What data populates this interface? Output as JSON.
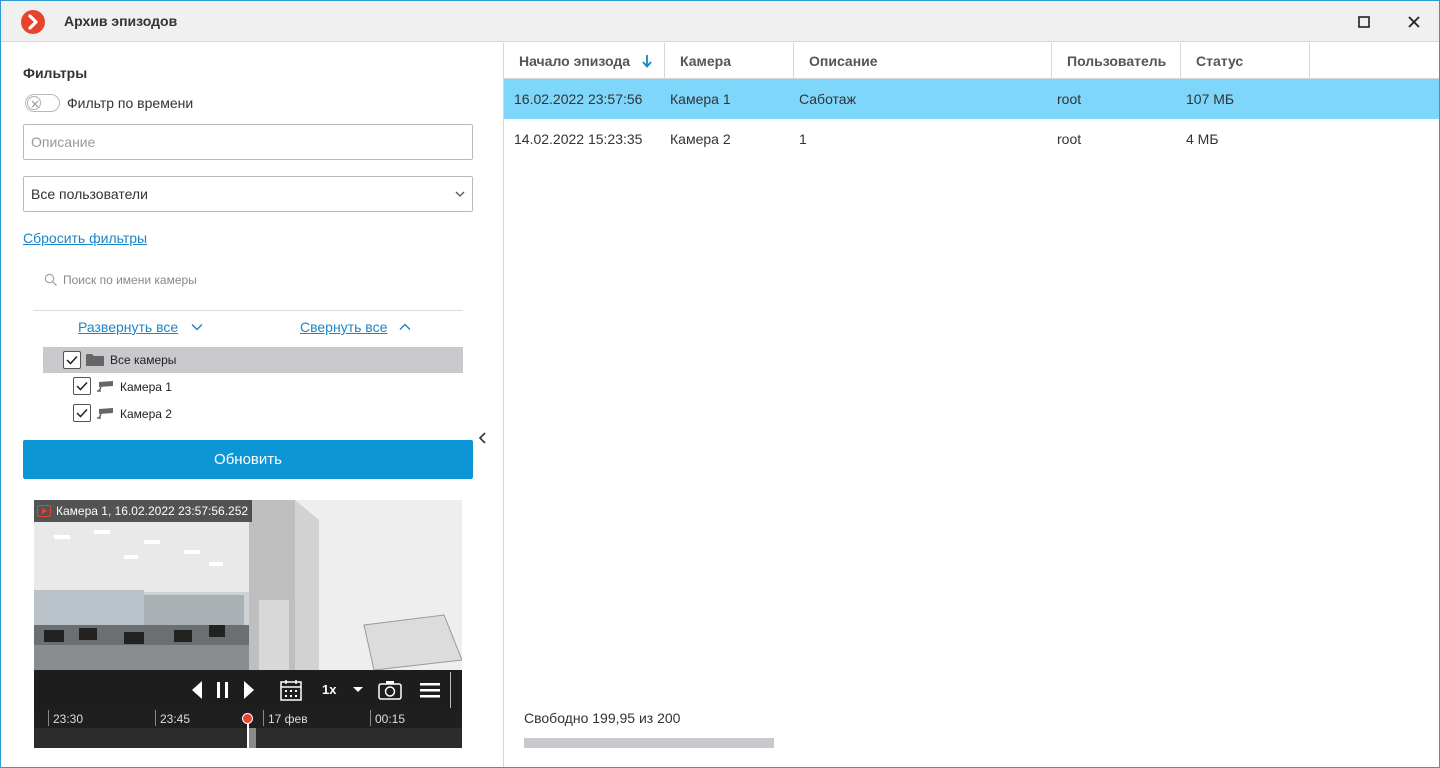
{
  "window": {
    "title": "Архив эпизодов",
    "accent": "#0c96d6",
    "brand": "#e8432c"
  },
  "filters": {
    "title": "Фильтры",
    "time_filter_label": "Фильтр по времени",
    "time_filter_on": false,
    "description_placeholder": "Описание",
    "description_value": "",
    "users_selected": "Все пользователи",
    "reset_label": "Сбросить фильтры",
    "camera_search_placeholder": "Поиск по имени камеры",
    "expand_all": "Развернуть все",
    "collapse_all": "Свернуть все",
    "tree": {
      "root_label": "Все камеры",
      "cameras": [
        {
          "label": "Камера 1",
          "checked": true
        },
        {
          "label": "Камера 2",
          "checked": true
        }
      ]
    },
    "refresh_label": "Обновить"
  },
  "player": {
    "caption": "Камера 1, 16.02.2022 23:57:56.252",
    "speed": "1x",
    "timeline": [
      "23:30",
      "23:45",
      "17 фев",
      "00:15"
    ]
  },
  "table": {
    "columns": [
      "Начало эпизода",
      "Камера",
      "Описание",
      "Пользователь",
      "Статус"
    ],
    "sort_column": "Начало эпизода",
    "sort_direction": "descending",
    "rows": [
      {
        "start": "16.02.2022 23:57:56",
        "camera": "Камера 1",
        "description": "Саботаж",
        "user": "root",
        "status": "107 МБ",
        "selected": true
      },
      {
        "start": "14.02.2022 15:23:35",
        "camera": "Камера 2",
        "description": "1",
        "user": "root",
        "status": "4 МБ",
        "selected": false
      }
    ]
  },
  "storage": {
    "label": "Свободно 199,95 из 200",
    "used_fraction": 0.00025
  }
}
